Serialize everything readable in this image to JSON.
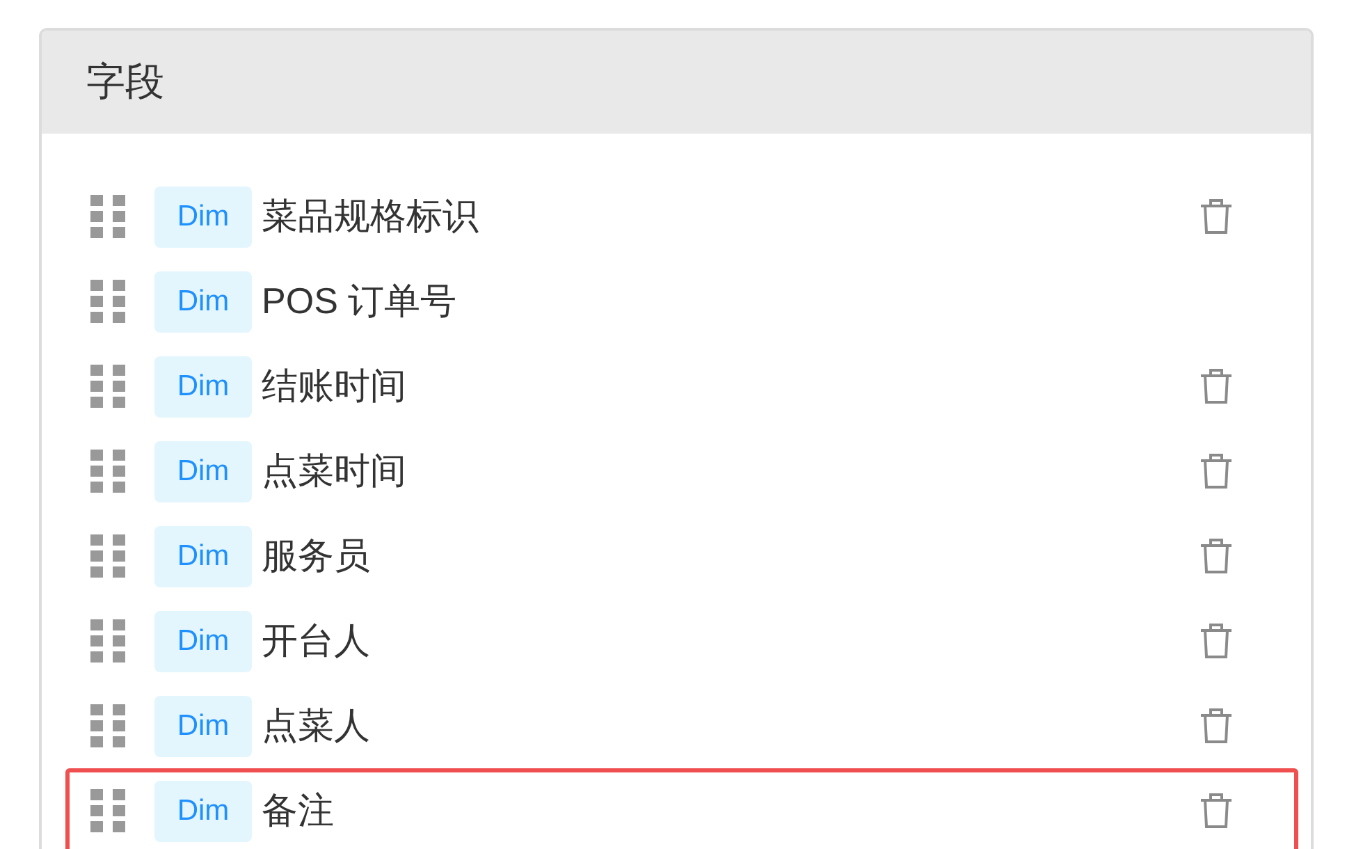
{
  "panel": {
    "title": "字段"
  },
  "fields": [
    {
      "tag": "Dim",
      "name": "菜品规格标识",
      "deletable": true,
      "highlighted": false
    },
    {
      "tag": "Dim",
      "name": "POS 订单号",
      "deletable": false,
      "highlighted": false
    },
    {
      "tag": "Dim",
      "name": "结账时间",
      "deletable": true,
      "highlighted": false
    },
    {
      "tag": "Dim",
      "name": "点菜时间",
      "deletable": true,
      "highlighted": false
    },
    {
      "tag": "Dim",
      "name": "服务员",
      "deletable": true,
      "highlighted": false
    },
    {
      "tag": "Dim",
      "name": "开台人",
      "deletable": true,
      "highlighted": false
    },
    {
      "tag": "Dim",
      "name": "点菜人",
      "deletable": true,
      "highlighted": false
    },
    {
      "tag": "Dim",
      "name": "备注",
      "deletable": true,
      "highlighted": true
    }
  ]
}
